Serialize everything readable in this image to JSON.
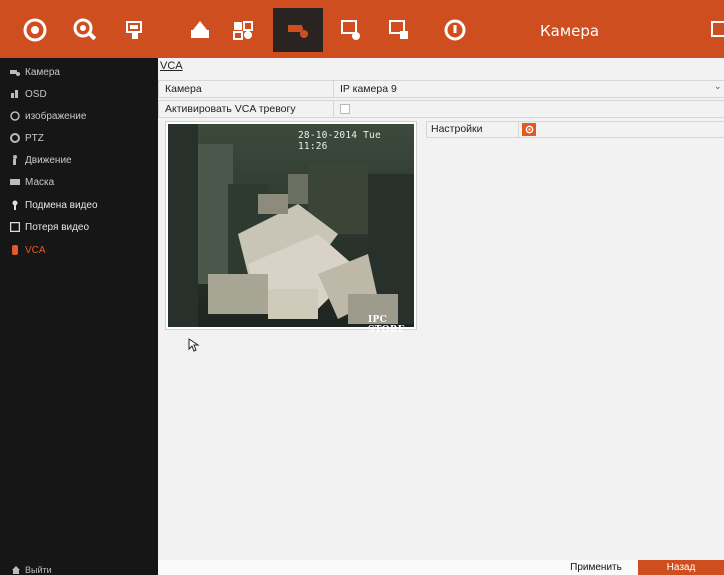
{
  "header": {
    "title": "Камера",
    "tools": [
      {
        "icon": "playback-icon"
      },
      {
        "icon": "search-icon"
      },
      {
        "icon": "camera-list-icon"
      },
      {
        "icon": "hdd-warning-icon"
      },
      {
        "icon": "system-config-icon"
      },
      {
        "icon": "camera-settings-icon",
        "active": true
      },
      {
        "icon": "display-settings-icon"
      },
      {
        "icon": "network-settings-icon"
      },
      {
        "icon": "power-icon"
      }
    ],
    "accent_color": "#cf4e1f"
  },
  "sidebar": {
    "items": [
      {
        "label": "Камера",
        "icon": "camera-icon"
      },
      {
        "label": "OSD",
        "icon": "osd-icon"
      },
      {
        "label": "изображение",
        "icon": "image-icon"
      },
      {
        "label": "PTZ",
        "icon": "ptz-icon"
      },
      {
        "label": "Движение",
        "icon": "motion-icon"
      },
      {
        "label": "Маска",
        "icon": "mask-icon"
      },
      {
        "label": "Подмена видео",
        "icon": "tamper-icon"
      },
      {
        "label": "Потеря видео",
        "icon": "video-loss-icon"
      },
      {
        "label": "VCA",
        "icon": "vca-icon",
        "active": true
      }
    ],
    "exit_label": "Выйти"
  },
  "main": {
    "breadcrumb": "VCA",
    "camera_label": "Камера",
    "camera_value": "IP камера 9",
    "enable_label": "Активировать VCA тревогу",
    "enable_checked": false,
    "settings_label": "Настройки",
    "preview": {
      "timestamp": "28-10-2014 Tue 11:26",
      "camera_name": "IPC STORE"
    }
  },
  "footer": {
    "apply_label": "Применить",
    "back_label": "Назад"
  }
}
